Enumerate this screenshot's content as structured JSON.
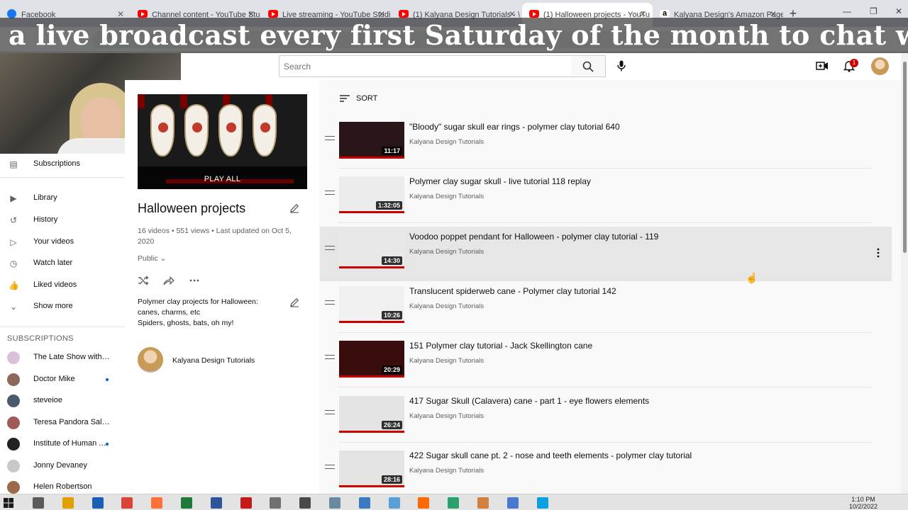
{
  "browser": {
    "tabs": [
      {
        "title": "Facebook",
        "favicon": "facebook-icon"
      },
      {
        "title": "Channel content - YouTube Stu",
        "favicon": "youtube-icon"
      },
      {
        "title": "Live streaming - YouTube Studi",
        "favicon": "youtube-icon"
      },
      {
        "title": "(1) Kalyana Design Tutorials - \\",
        "favicon": "youtube-icon"
      },
      {
        "title": "(1) Halloween projects - YouTu",
        "favicon": "youtube-icon",
        "active": true
      },
      {
        "title": "Kalyana Design's Amazon Page",
        "favicon": "amazon-icon"
      }
    ],
    "new_tab": "+",
    "window_controls": [
      "—",
      "❐",
      "✕"
    ]
  },
  "caption": "a live broadcast every first Saturday of the month to chat with my",
  "header": {
    "search_placeholder": "Search",
    "notification_count": "1"
  },
  "nav": {
    "items": [
      {
        "label": "Subscriptions",
        "icon": "subscriptions-icon",
        "glyph": "▤"
      },
      {
        "label": "Library",
        "icon": "library-icon",
        "glyph": "▶"
      },
      {
        "label": "History",
        "icon": "history-icon",
        "glyph": "↺"
      },
      {
        "label": "Your videos",
        "icon": "your-videos-icon",
        "glyph": "▷"
      },
      {
        "label": "Watch later",
        "icon": "watch-later-icon",
        "glyph": "◷"
      },
      {
        "label": "Liked videos",
        "icon": "liked-videos-icon",
        "glyph": "👍"
      },
      {
        "label": "Show more",
        "icon": "chevron-down-icon",
        "glyph": "⌄"
      }
    ],
    "subscriptions_heading": "SUBSCRIPTIONS",
    "subscriptions": [
      {
        "label": "The Late Show with Stephen Colbert",
        "color": "#d9c2d9",
        "new": false
      },
      {
        "label": "Doctor Mike",
        "color": "#8a6a5a",
        "new": true
      },
      {
        "label": "steveioe",
        "color": "#4a5a6a",
        "new": false
      },
      {
        "label": "Teresa Pandora Salgueiro",
        "color": "#a05a5a",
        "new": false
      },
      {
        "label": "Institute of Human Anatomy",
        "color": "#222222",
        "new": true
      },
      {
        "label": "Jonny Devaney",
        "color": "#c8c8c8",
        "new": false
      },
      {
        "label": "Helen Robertson",
        "color": "#9a6a4a",
        "new": false
      }
    ]
  },
  "playlist": {
    "play_all": "PLAY ALL",
    "title": "Halloween projects",
    "meta": "16 videos • 551 views • Last updated on Oct 5, 2020",
    "visibility": "Public",
    "description_lines": [
      "Polymer clay projects for Halloween:",
      "canes, charms, etc",
      "Spiders, ghosts, bats, oh my!"
    ],
    "owner": "Kalyana Design Tutorials"
  },
  "videos": {
    "sort_label": "SORT",
    "items": [
      {
        "title": "\"Bloody\" sugar skull ear rings - polymer clay tutorial 640",
        "channel": "Kalyana Design Tutorials",
        "duration": "11:17",
        "bg": "#2a1518"
      },
      {
        "title": "Polymer clay sugar skull - live tutorial 118 replay",
        "channel": "Kalyana Design Tutorials",
        "duration": "1:32:05",
        "bg": "#ececec"
      },
      {
        "title": "Voodoo poppet pendant for Halloween - polymer clay tutorial - 119",
        "channel": "Kalyana Design Tutorials",
        "duration": "14:30",
        "bg": "#e8e8e8"
      },
      {
        "title": "Translucent spiderweb cane - Polymer clay tutorial 142",
        "channel": "Kalyana Design Tutorials",
        "duration": "10:26",
        "bg": "#f0f0f0"
      },
      {
        "title": "151 Polymer clay tutorial - Jack Skellington cane",
        "channel": "Kalyana Design Tutorials",
        "duration": "20:29",
        "bg": "#3a0d0d"
      },
      {
        "title": "417 Sugar Skull (Calavera) cane - part 1 - eye flowers elements",
        "channel": "Kalyana Design Tutorials",
        "duration": "26:24",
        "bg": "#e4e4e4"
      },
      {
        "title": "422 Sugar skull cane pt. 2 - nose and teeth elements - polymer clay tutorial",
        "channel": "Kalyana Design Tutorials",
        "duration": "28:16",
        "bg": "#e4e4e4"
      }
    ]
  },
  "taskbar": {
    "time": "1:10 PM",
    "date": "10/2/2022"
  }
}
